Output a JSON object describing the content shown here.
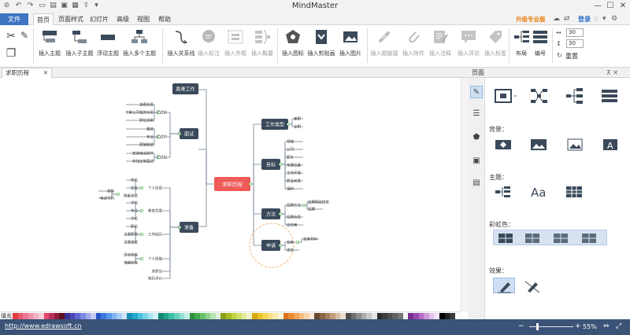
{
  "app": {
    "title": "MindMaster"
  },
  "menu": {
    "file": "文件",
    "tabs": [
      "首页",
      "页面样式",
      "幻灯片",
      "高级",
      "视图",
      "帮助"
    ],
    "upgrade": "升级专业版",
    "login": "登录"
  },
  "ribbon": {
    "insert_main_topic": "插入主题",
    "insert_sub_topic": "插入子主题",
    "floating_topic": "浮动主题",
    "insert_multiple": "插入多个主题",
    "insert_relation": "插入关系线",
    "insert_callout": "插入标注",
    "insert_boundary": "插入外框",
    "insert_summary": "插入概要",
    "insert_icon": "插入图标",
    "insert_clipart": "插入剪贴画",
    "insert_image": "插入图片",
    "insert_hyperlink": "插入超链接",
    "insert_attachment": "插入附件",
    "insert_note": "插入注释",
    "insert_comment": "插入评论",
    "insert_tag": "插入标签",
    "layout": "布局",
    "numbering": "编号",
    "spacing_h": "30",
    "spacing_v": "30",
    "reset": "重置"
  },
  "doc_tab": {
    "name": "求职历程"
  },
  "panel": {
    "title": "页面",
    "background": "背景：",
    "theme": "主题：",
    "rainbow": "彩虹色：",
    "effect": "效果："
  },
  "mindmap": {
    "root": "求职历程",
    "branches": [
      {
        "label": "跌难工作"
      },
      {
        "label": "面试",
        "subs": [
          {
            "label": "面试前",
            "leaves": [
              "查看信息",
              "了解公司相关信息",
              "职位说明"
            ]
          },
          {
            "label": "面试中",
            "leaves": [
              "着装",
              "专业",
              "薪酬期望"
            ]
          },
          {
            "label": "面试后",
            "leaves": [
              "感谢电话邮件",
              "参加正常面试"
            ]
          }
        ]
      },
      {
        "label": "准备",
        "subs": [
          {
            "label": "个人信息",
            "leaves": [
              "姓名",
              "住址",
              "联系方式"
            ],
            "extra": [
              "邮箱",
              "电话号码"
            ]
          },
          {
            "label": "教育背景",
            "leaves": [
              "学校",
              "专业",
              "学位"
            ]
          },
          {
            "label": "工作经历",
            "leaves": [
              "职位",
              "主要职责",
              "主要成就"
            ]
          },
          {
            "label": "个人技能",
            "leaves": [
              "语言技能",
              "电脑技能"
            ]
          },
          {
            "label": "求职信"
          },
          {
            "label": "简历评价"
          }
        ]
      },
      {
        "label": "工作类型",
        "subs": [
          {
            "label": "兼职"
          },
          {
            "label": "全职"
          }
        ]
      },
      {
        "label": "目标",
        "subs": [
          {
            "label": "领域"
          },
          {
            "label": "公司"
          },
          {
            "label": "薪水"
          },
          {
            "label": "地理位置"
          },
          {
            "label": "工作环境"
          },
          {
            "label": "职业前景"
          },
          {
            "label": "福利"
          }
        ]
      },
      {
        "label": "方法",
        "subs": [
          {
            "label": "招聘方法",
            "leaves": [
              "招聘网站搜索",
              "招聘"
            ]
          },
          {
            "label": "招聘信息"
          },
          {
            "label": "投资者"
          }
        ]
      },
      {
        "label": "申请",
        "subs": [
          {
            "label": "准备",
            "leaves": [
              "准备材料"
            ]
          },
          {
            "label": "现在"
          }
        ]
      }
    ]
  },
  "palette": {
    "label": "填充",
    "colors": [
      "#e23b3b",
      "#e8596e",
      "#ea7793",
      "#ee93ac",
      "#f3b1c3",
      "#f7cfd9",
      "#e3466f",
      "#b82f57",
      "#8e1d3a",
      "#5e0f24",
      "#3b2f8f",
      "#4b49b8",
      "#5f67d1",
      "#7c89e0",
      "#a0aaea",
      "#c5ccf3",
      "#2856c9",
      "#3d78e0",
      "#5a97ea",
      "#81b4f1",
      "#a9cdf6",
      "#d0e4fa",
      "#1a8fb5",
      "#22aacf",
      "#4bc2dd",
      "#79d4e7",
      "#a7e4ef",
      "#d2f2f7",
      "#138a6f",
      "#1fa58b",
      "#3abfa4",
      "#63d0b8",
      "#92e0cd",
      "#c5f0e4",
      "#2f8f3a",
      "#44aa4c",
      "#66c067",
      "#8fd28b",
      "#b8e3b3",
      "#ddf1da",
      "#8c9f1a",
      "#a7bb25",
      "#c0d23f",
      "#d3e06a",
      "#e2eb98",
      "#f0f5c9",
      "#d8a80f",
      "#eec324",
      "#f6d54f",
      "#f9e17f",
      "#fbebab",
      "#fdf5d6",
      "#d8721c",
      "#ec8a2c",
      "#f3a456",
      "#f6bc81",
      "#f9d3ad",
      "#fce9d7",
      "#6b4a2f",
      "#8a6443",
      "#a67e5c",
      "#c19d7f",
      "#d8bea6",
      "#ecdfd2",
      "#505050",
      "#6e6e6e",
      "#8c8c8c",
      "#aaaaaa",
      "#c8c8c8",
      "#e6e6e6",
      "#2b2b2b",
      "#3c3c3c",
      "#4e4e4e",
      "#616161",
      "#757575",
      "#f5f5f5",
      "#7a2f8f",
      "#9a46b0",
      "#b86bc9",
      "#cf97dc",
      "#e3c1ea",
      "#f2e2f5",
      "#000000",
      "#1f1f1f",
      "#3a3a3a",
      "#ffffff"
    ]
  },
  "status": {
    "url": "http://www.edrawsoft.cn",
    "zoom": "55%"
  },
  "colors": {
    "accent": "#3c74c2",
    "root": "#ef5b57",
    "topic": "#3b4a5a",
    "status_bar": "#3a5376",
    "upgrade": "#e77d0c"
  }
}
